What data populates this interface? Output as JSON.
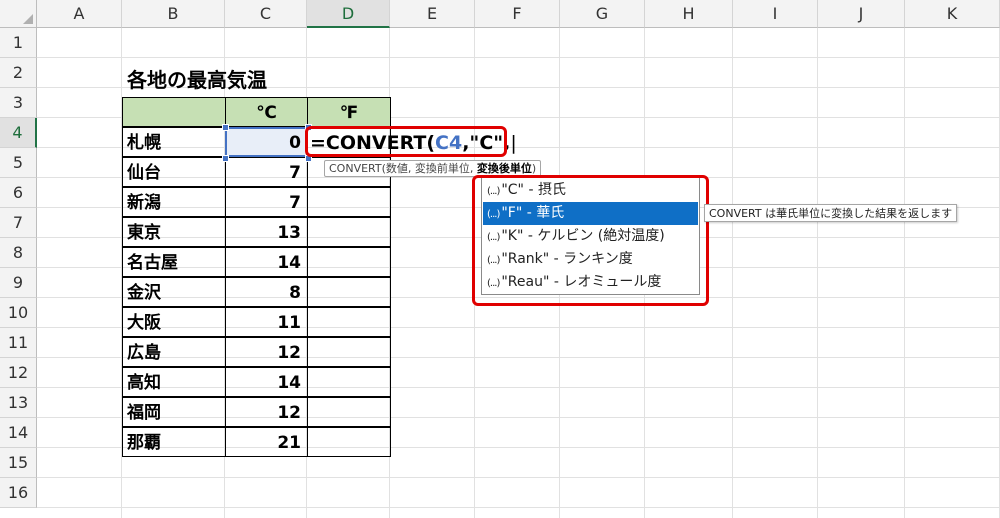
{
  "columns": [
    "A",
    "B",
    "C",
    "D",
    "E",
    "F",
    "G",
    "H",
    "I",
    "J",
    "K"
  ],
  "rows": [
    "1",
    "2",
    "3",
    "4",
    "5",
    "6",
    "7",
    "8",
    "9",
    "10",
    "11",
    "12",
    "13",
    "14",
    "15",
    "16"
  ],
  "title": "各地の最高気温",
  "table": {
    "header_c": "℃",
    "header_d": "℉",
    "rows": [
      {
        "city": "札幌",
        "temp": "0"
      },
      {
        "city": "仙台",
        "temp": "7"
      },
      {
        "city": "新潟",
        "temp": "7"
      },
      {
        "city": "東京",
        "temp": "13"
      },
      {
        "city": "名古屋",
        "temp": "14"
      },
      {
        "city": "金沢",
        "temp": "8"
      },
      {
        "city": "大阪",
        "temp": "11"
      },
      {
        "city": "広島",
        "temp": "12"
      },
      {
        "city": "高知",
        "temp": "14"
      },
      {
        "city": "福岡",
        "temp": "12"
      },
      {
        "city": "那覇",
        "temp": "21"
      }
    ]
  },
  "formula": {
    "prefix": "=CONVERT(",
    "ref": "C4",
    "suffix": ",\"C\","
  },
  "tooltip": {
    "text": "CONVERT(数値, 変換前単位, ",
    "bold": "変換後単位",
    "end": ")"
  },
  "dropdown": {
    "icon": "(...)",
    "items": [
      "\"C\" - 摂氏",
      "\"F\" - 華氏",
      "\"K\" - ケルビン (絶対温度)",
      "\"Rank\" - ランキン度",
      "\"Reau\" - レオミュール度"
    ],
    "selected_index": 1
  },
  "item_tooltip": "CONVERT は華氏単位に変換した結果を返します",
  "colors": {
    "header_fill": "#c6e0b4",
    "highlight_box": "#e00000",
    "selected_item": "#0f6fc6",
    "cell_ref": "#4472c4"
  }
}
